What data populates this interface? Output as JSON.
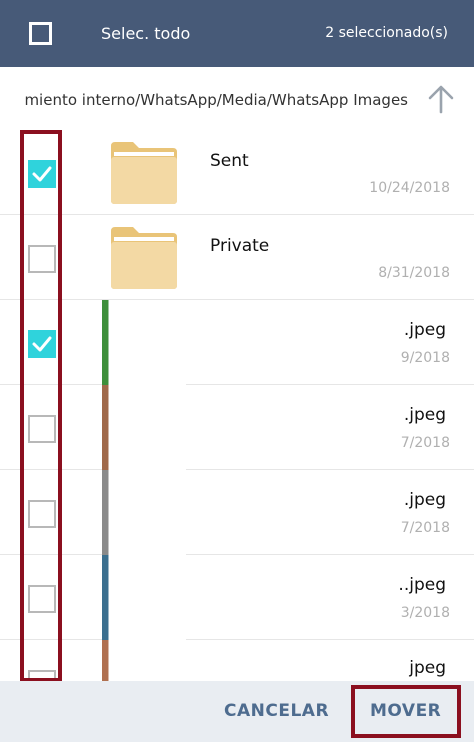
{
  "header": {
    "select_all_label": "Selec. todo",
    "selected_count": "2 seleccionado(s)"
  },
  "path": {
    "text": "miento interno/WhatsApp/Media/WhatsApp Images"
  },
  "items": [
    {
      "name": "Sent",
      "date": "10/24/2018",
      "checked": true,
      "type": "folder"
    },
    {
      "name": "Private",
      "date": "8/31/2018",
      "checked": false,
      "type": "folder"
    },
    {
      "ext": ".jpeg",
      "date_partial": "9/2018",
      "checked": true,
      "type": "image"
    },
    {
      "ext": ".jpeg",
      "date_partial": "7/2018",
      "checked": false,
      "type": "image"
    },
    {
      "ext": ".jpeg",
      "date_partial": "7/2018",
      "checked": false,
      "type": "image"
    },
    {
      "ext": "..jpeg",
      "date_partial": "3/2018",
      "checked": false,
      "type": "image"
    },
    {
      "ext": "jpeg",
      "date_partial": "",
      "checked": false,
      "type": "image"
    }
  ],
  "footer": {
    "cancel_label": "CANCELAR",
    "move_label": "MOVER"
  },
  "colors": {
    "header_bg": "#475a78",
    "checkbox_checked": "#2fd3dc",
    "highlight": "#8b0f1f",
    "button_text": "#4e6c8f"
  }
}
